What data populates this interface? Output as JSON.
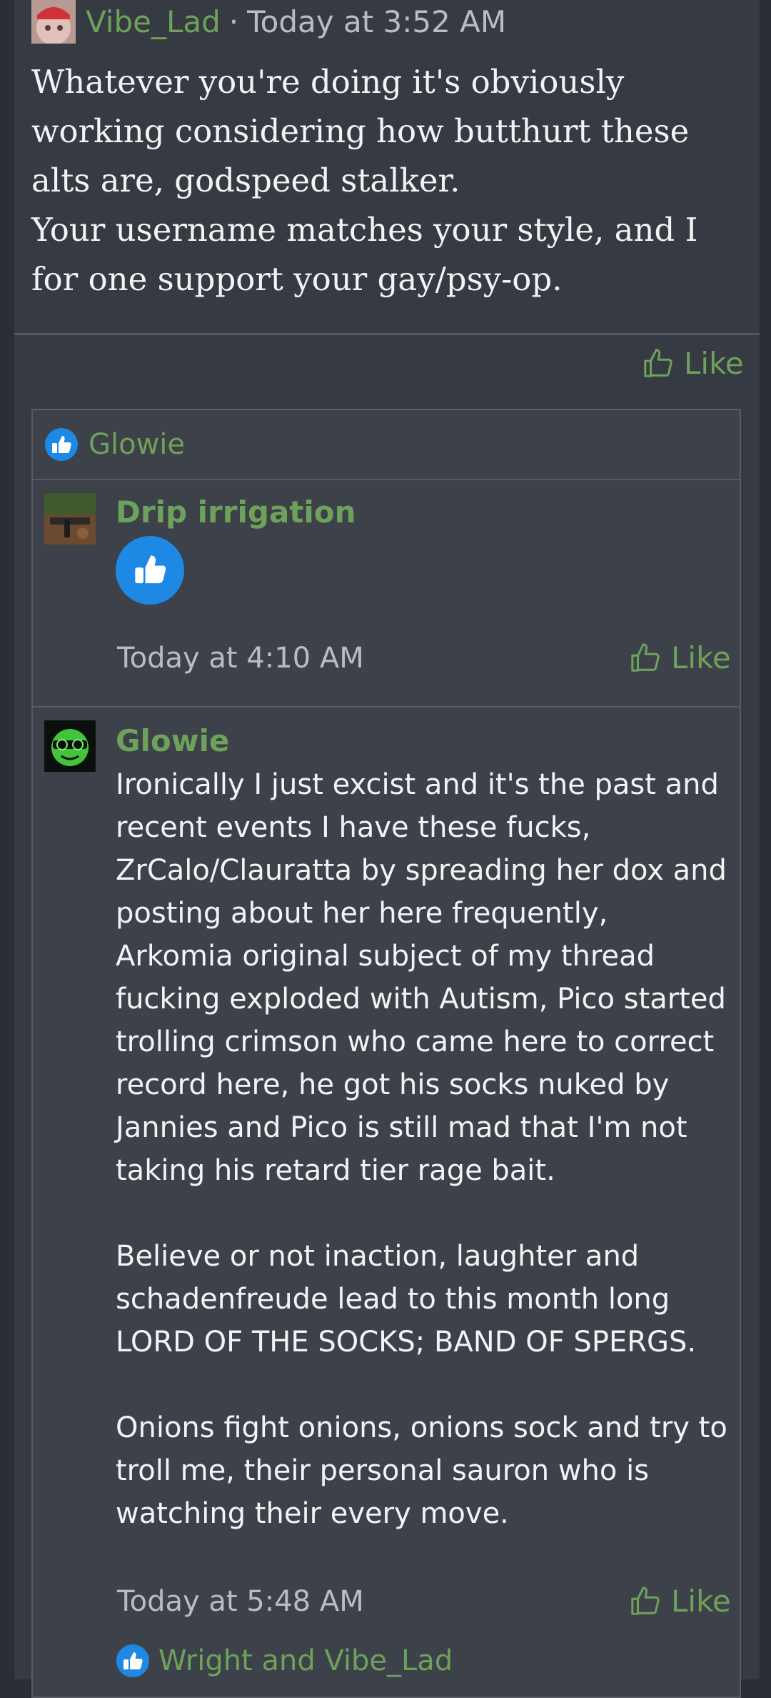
{
  "post": {
    "author": "Vibe_Lad",
    "separator": "·",
    "timestamp": "Today at 3:52 AM",
    "body": [
      "Whatever you're doing it's obviously working considering how butthurt these alts are, godspeed stalker.",
      "Your username matches your style, and I for one support your gay/psy-op."
    ],
    "like_label": "Like"
  },
  "reactions": {
    "names": "Glowie"
  },
  "comments": [
    {
      "author": "Drip irrigation",
      "timestamp": "Today at 4:10 AM",
      "like_label": "Like"
    },
    {
      "author": "Glowie",
      "paragraphs": [
        "Ironically I just excist and it's the past and recent events I have these fucks, ZrCalo/Clauratta by spreading her dox and posting about her here frequently, Arkomia original subject of my thread fucking exploded with Autism, Pico started trolling crimson who came here to correct record here, he got his socks nuked by Jannies and Pico is still mad that I'm not taking his retard tier rage bait.",
        "Believe or not inaction, laughter and schadenfreude lead to this month long LORD OF THE SOCKS; BAND OF SPERGS.",
        "Onions fight onions, onions sock and try to troll me, their personal sauron who is watching their every move."
      ],
      "timestamp": "Today at 5:48 AM",
      "like_label": "Like",
      "reaction_names": "Wright and Vibe_Lad"
    }
  ],
  "colors": {
    "accent_green": "#6ea15a",
    "like_blue": "#1e88e5",
    "background": "#2b2e35",
    "card": "#363a43"
  },
  "icons": [
    "thumbs-up-outline-icon",
    "thumbs-up-reaction-icon"
  ]
}
